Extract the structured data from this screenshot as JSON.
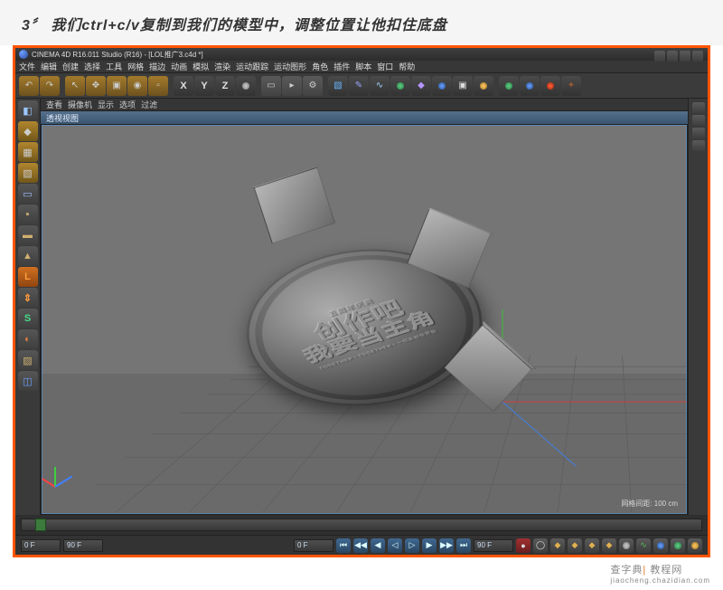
{
  "step_number": "3",
  "step_symbol": "〞",
  "step_text": "我们ctrl+c/v复制到我们的模型中，调整位置让他扣住底盘",
  "window": {
    "title": "CINEMA 4D R16.011 Studio (R16) - [LOL推广3.c4d *]"
  },
  "menubar": [
    "文件",
    "编辑",
    "创建",
    "选择",
    "工具",
    "网格",
    "描边",
    "动画",
    "模拟",
    "渲染",
    "运动跟踪",
    "运动图形",
    "角色",
    "插件",
    "脚本",
    "窗口",
    "帮助"
  ],
  "toolbar_axis": [
    "X",
    "Y",
    "Z"
  ],
  "view_tabs": [
    "查看",
    "摄像机",
    "显示",
    "选项",
    "过滤"
  ],
  "view_header": "透视视图",
  "viewport_footer": "网格间距: 100 cm",
  "medal": {
    "sub": "五周年庆典",
    "line1": "创作吧",
    "line2": "我要当主角",
    "small": "TOGETHER・TOGETHER・一切从创作开始"
  },
  "timeline": {
    "start": "0 F",
    "end": "90 F",
    "cur": "0 F",
    "range_end": "90 F"
  },
  "watermark": {
    "left": "查字典",
    "bar": "|",
    "right": "教程网",
    "url": "jiaocheng.chazidian.com"
  }
}
